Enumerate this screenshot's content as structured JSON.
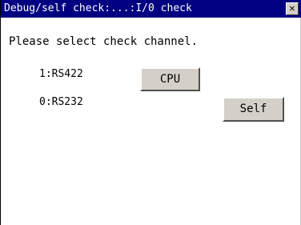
{
  "window": {
    "title": "Debug/self check:...:I/0 check",
    "close_glyph": "✕"
  },
  "content": {
    "prompt": "Please select check channel.",
    "channels": [
      {
        "label": "1:RS422"
      },
      {
        "label": "0:RS232"
      }
    ]
  },
  "buttons": {
    "cpu_label": "CPU",
    "self_label": "Self"
  },
  "colors": {
    "title_bar": "#000080",
    "title_text": "#ffffff",
    "button_face": "#d4d0c8",
    "background": "#ffffff"
  }
}
